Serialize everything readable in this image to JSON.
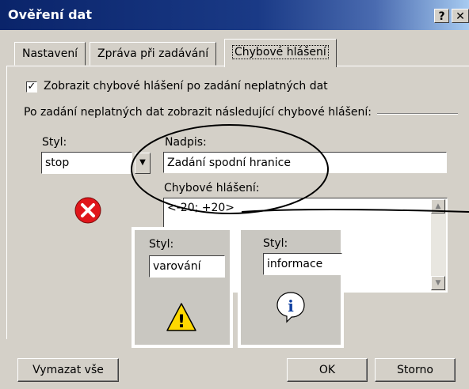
{
  "window": {
    "title": "Ověření dat",
    "help_glyph": "?",
    "close_glyph": "✕"
  },
  "tabs": [
    {
      "label": "Nastavení"
    },
    {
      "label": "Zpráva při zadávání"
    },
    {
      "label": "Chybové hlášení"
    }
  ],
  "panel": {
    "show_error_checkbox_label": "Zobrazit chybové hlášení po zadání neplatných dat",
    "checkbox_mark": "✓",
    "checked": true,
    "group_label": "Po zadání neplatných dat zobrazit následující chybové hlášení:",
    "style_label": "Styl:",
    "style_value": "stop",
    "title_label": "Nadpis:",
    "title_value": "Zadání spodní hranice",
    "message_label": "Chybové hlášení:",
    "message_value": "<-20; +20>"
  },
  "overlays": {
    "warning": {
      "style_label": "Styl:",
      "style_value": "varování",
      "icon": "warning-icon",
      "icon_glyph": "!"
    },
    "information": {
      "style_label": "Styl:",
      "style_value": "informace",
      "icon": "info-icon",
      "icon_glyph": "i"
    }
  },
  "buttons": {
    "clear_all": "Vymazat vše",
    "ok": "OK",
    "cancel": "Storno"
  },
  "colors": {
    "title_bar": "#0a246a",
    "dialog_bg": "#d4d0c8",
    "stop_icon": "#e0161b",
    "warning_icon": "#ffd800",
    "info_icon": "#1040a0"
  }
}
